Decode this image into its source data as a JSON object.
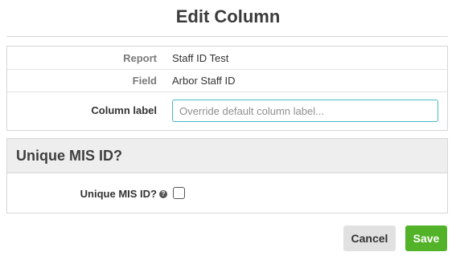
{
  "dialog": {
    "title": "Edit Column"
  },
  "details": {
    "report_label": "Report",
    "report_value": "Staff ID Test",
    "field_label": "Field",
    "field_value": "Arbor Staff ID",
    "column_label_label": "Column label",
    "column_label_placeholder": "Override default column label...",
    "column_label_value": ""
  },
  "mis_section": {
    "heading": "Unique MIS ID?",
    "checkbox_label": "Unique MIS ID?",
    "help_icon": "question-circle-icon",
    "checked": false
  },
  "footer": {
    "cancel_label": "Cancel",
    "save_label": "Save"
  },
  "colors": {
    "save_button": "#52b329",
    "cancel_button": "#e2e1e1",
    "input_focus_border": "#45b8c8",
    "section_header_bg": "#efeeee"
  }
}
